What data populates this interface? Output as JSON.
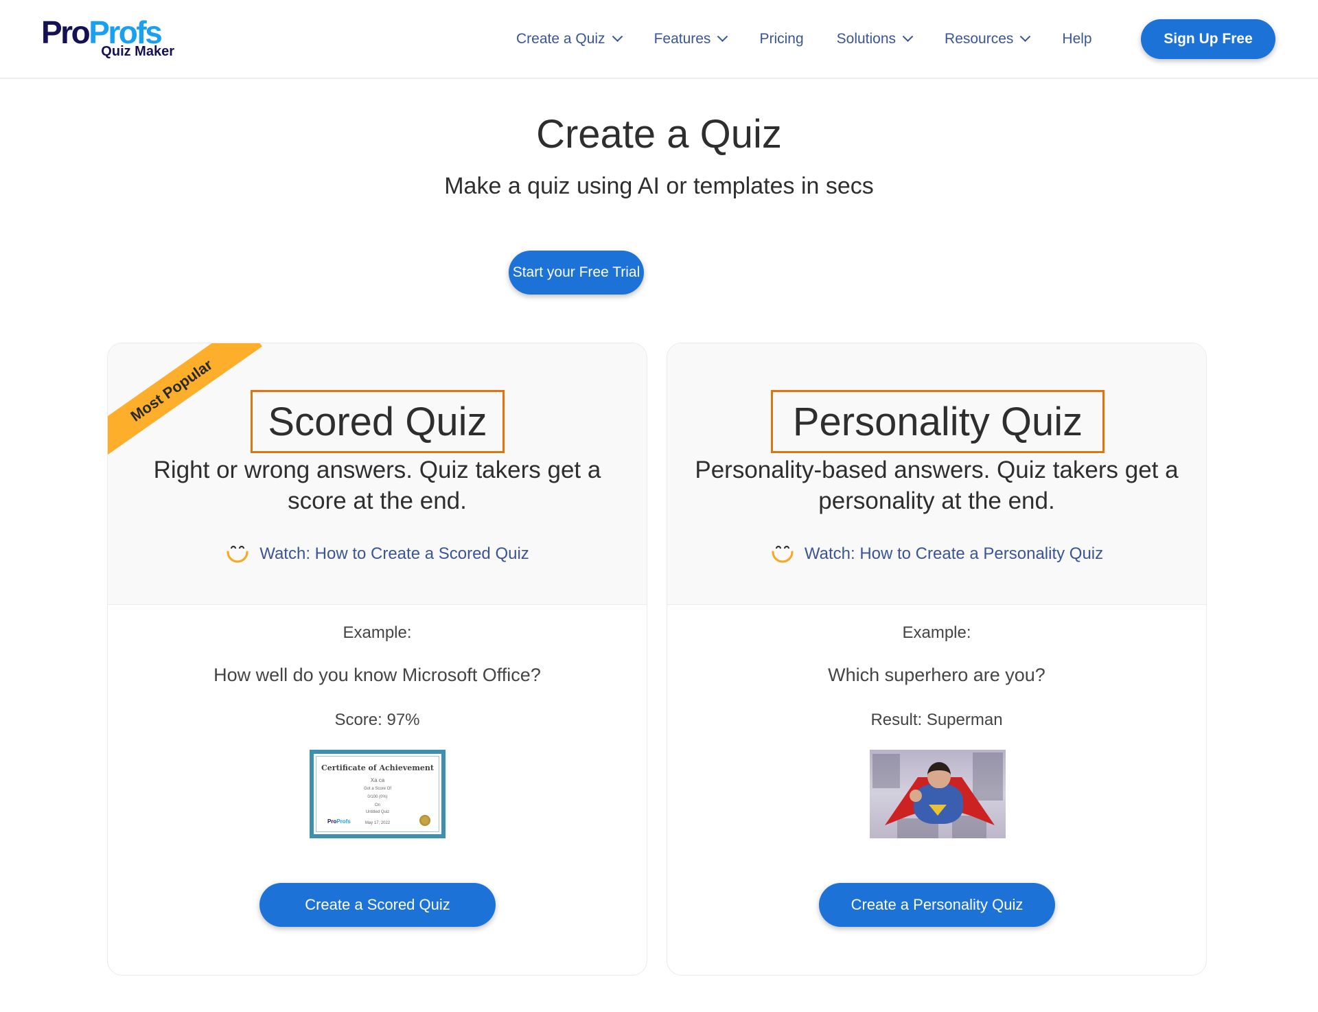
{
  "header": {
    "logo": {
      "pro": "Pro",
      "profs": "Profs",
      "sub": "Quiz Maker"
    },
    "nav": [
      {
        "label": "Create a Quiz",
        "has_dropdown": true
      },
      {
        "label": "Features",
        "has_dropdown": true
      },
      {
        "label": "Pricing",
        "has_dropdown": false
      },
      {
        "label": "Solutions",
        "has_dropdown": true
      },
      {
        "label": "Resources",
        "has_dropdown": true
      },
      {
        "label": "Help",
        "has_dropdown": false
      }
    ],
    "signup_label": "Sign Up Free"
  },
  "hero": {
    "title": "Create a Quiz",
    "subtitle": "Make a quiz using AI or templates in secs",
    "cta_label": "Start your Free Trial"
  },
  "cards": [
    {
      "badge": "Most Popular",
      "title": "Scored Quiz",
      "description": "Right or wrong answers. Quiz takers get a score at the end.",
      "watch_label": "Watch: How to Create a Scored Quiz",
      "example_label": "Example:",
      "example_question": "How well do you know Microsoft Office?",
      "example_result": "Score: 97%",
      "image_alt": "Certificate of Achievement",
      "certificate": {
        "title": "Certificate of Achievement",
        "name": "Xa ca",
        "line1": "Got a Score Of",
        "line2": "0/100 (0%)",
        "line3": "On",
        "line4": "Untitled Quiz",
        "date": "May 17, 2022",
        "logo": "ProProfs"
      },
      "button_label": "Create a Scored Quiz"
    },
    {
      "title": "Personality Quiz",
      "description": "Personality-based answers. Quiz takers get a personality at the end.",
      "watch_label": "Watch: How to Create a Personality Quiz",
      "example_label": "Example:",
      "example_question": "Which superhero are you?",
      "example_result": "Result: Superman",
      "image_alt": "Superman flying",
      "button_label": "Create a Personality Quiz"
    }
  ],
  "colors": {
    "primary": "#1c72d6",
    "nav_text": "#3a5595",
    "logo_dark": "#141154",
    "logo_light": "#1aa0f0",
    "ribbon": "#fdae2b",
    "title_border": "#e0750f"
  }
}
